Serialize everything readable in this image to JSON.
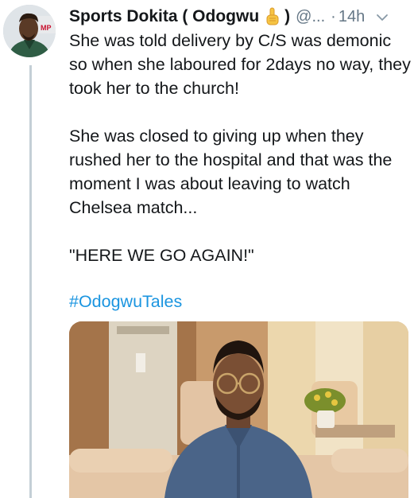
{
  "author": {
    "display_name": "Sports Dokita ( Odogwu",
    "emoji": "index-pointing-up-emoji",
    "close_paren": ")",
    "handle": "@...",
    "separator": "·",
    "timestamp": "14h"
  },
  "body": {
    "paragraph_1": "She was told delivery by C/S was demonic so when she laboured for 2days no way, they took her to the church!",
    "paragraph_2": "She was closed to giving up when they rushed her to the hospital and that was the moment I was about leaving to watch Chelsea match...",
    "paragraph_3": "\"HERE WE GO AGAIN!\"",
    "hashtag": "#OdogwuTales"
  },
  "icons": {
    "menu": "chevron-down-icon",
    "avatar": "profile-avatar"
  },
  "colors": {
    "text": "#14171a",
    "muted": "#657786",
    "link": "#1b95e0",
    "thread_line": "#c4cfd6"
  }
}
